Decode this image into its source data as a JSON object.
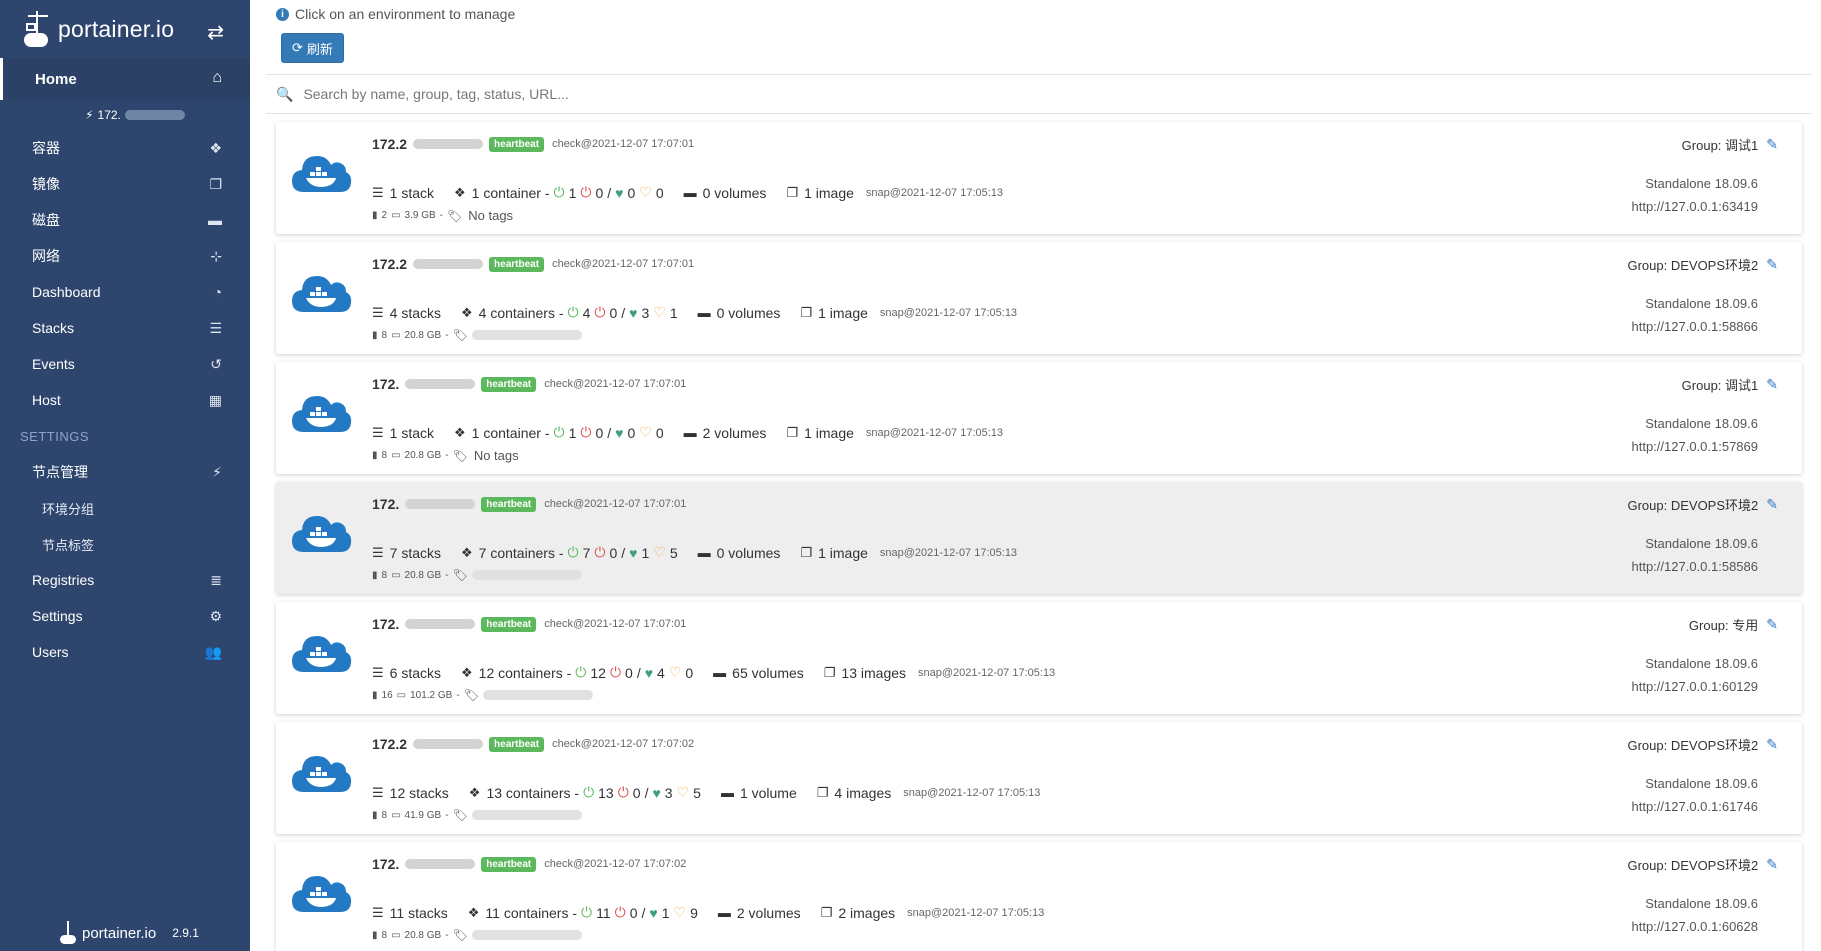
{
  "sidebar": {
    "brand": "portainer.io",
    "home_label": "Home",
    "endpoint_label": "172.",
    "items": [
      {
        "label": "容器",
        "icon": "cubes-icon"
      },
      {
        "label": "镜像",
        "icon": "clone-icon"
      },
      {
        "label": "磁盘",
        "icon": "hdd-icon"
      },
      {
        "label": "网络",
        "icon": "sitemap-icon"
      },
      {
        "label": "Dashboard",
        "icon": "dashboard-icon"
      },
      {
        "label": "Stacks",
        "icon": "th-list-icon"
      },
      {
        "label": "Events",
        "icon": "history-icon"
      },
      {
        "label": "Host",
        "icon": "th-icon"
      }
    ],
    "settings_header": "SETTINGS",
    "settings_items": {
      "node_mgmt": "节点管理",
      "env_group": "环境分组",
      "node_tags": "节点标签",
      "registries": "Registries",
      "settings": "Settings",
      "users": "Users"
    },
    "footer_name": "portainer.io",
    "footer_version": "2.9.1"
  },
  "main": {
    "info_text": "Click on an environment to manage",
    "refresh_label": "刷新",
    "search_placeholder": "Search by name, group, tag, status, URL..."
  },
  "endpoints": [
    {
      "name": "172.2",
      "badge": "heartbeat",
      "check": "check@2021-12-07 17:07:01",
      "stacks": "1 stack",
      "containers": "1 container -",
      "running": "1",
      "stopped": "0",
      "healthy": "0",
      "unhealthy": "0",
      "volumes": "0 volumes",
      "images": "1 image",
      "snap": "snap@2021-12-07 17:05:13",
      "cpu": "2",
      "mem": "3.9 GB",
      "tags": "No tags",
      "group": "Group: 调试1",
      "standalone": "Standalone 18.09.6",
      "url": "http://127.0.0.1:63419"
    },
    {
      "name": "172.2",
      "badge": "heartbeat",
      "check": "check@2021-12-07 17:07:01",
      "stacks": "4 stacks",
      "containers": "4 containers -",
      "running": "4",
      "stopped": "0",
      "healthy": "3",
      "unhealthy": "1",
      "volumes": "0 volumes",
      "images": "1 image",
      "snap": "snap@2021-12-07 17:05:13",
      "cpu": "8",
      "mem": "20.8 GB",
      "tags": "-",
      "group": "Group: DEVOPS环境2",
      "standalone": "Standalone 18.09.6",
      "url": "http://127.0.0.1:58866"
    },
    {
      "name": "172.",
      "badge": "heartbeat",
      "check": "check@2021-12-07 17:07:01",
      "stacks": "1 stack",
      "containers": "1 container -",
      "running": "1",
      "stopped": "0",
      "healthy": "0",
      "unhealthy": "0",
      "volumes": "2 volumes",
      "images": "1 image",
      "snap": "snap@2021-12-07 17:05:13",
      "cpu": "8",
      "mem": "20.8 GB",
      "tags": "No tags",
      "group": "Group: 调试1",
      "standalone": "Standalone 18.09.6",
      "url": "http://127.0.0.1:57869"
    },
    {
      "name": "172.",
      "badge": "heartbeat",
      "check": "check@2021-12-07 17:07:01",
      "stacks": "7 stacks",
      "containers": "7 containers -",
      "running": "7",
      "stopped": "0",
      "healthy": "1",
      "unhealthy": "5",
      "volumes": "0 volumes",
      "images": "1 image",
      "snap": "snap@2021-12-07 17:05:13",
      "cpu": "8",
      "mem": "20.8 GB",
      "tags": "-",
      "group": "Group: DEVOPS环境2",
      "standalone": "Standalone 18.09.6",
      "url": "http://127.0.0.1:58586"
    },
    {
      "name": "172.",
      "badge": "heartbeat",
      "check": "check@2021-12-07 17:07:01",
      "stacks": "6 stacks",
      "containers": "12 containers -",
      "running": "12",
      "stopped": "0",
      "healthy": "4",
      "unhealthy": "0",
      "volumes": "65 volumes",
      "images": "13 images",
      "snap": "snap@2021-12-07 17:05:13",
      "cpu": "16",
      "mem": "101.2 GB",
      "tags": "-",
      "group": "Group: 专用",
      "standalone": "Standalone 18.09.6",
      "url": "http://127.0.0.1:60129"
    },
    {
      "name": "172.2",
      "badge": "heartbeat",
      "check": "check@2021-12-07 17:07:02",
      "stacks": "12 stacks",
      "containers": "13 containers -",
      "running": "13",
      "stopped": "0",
      "healthy": "3",
      "unhealthy": "5",
      "volumes": "1 volume",
      "images": "4 images",
      "snap": "snap@2021-12-07 17:05:13",
      "cpu": "8",
      "mem": "41.9 GB",
      "tags": "-",
      "group": "Group: DEVOPS环境2",
      "standalone": "Standalone 18.09.6",
      "url": "http://127.0.0.1:61746"
    },
    {
      "name": "172.",
      "badge": "heartbeat",
      "check": "check@2021-12-07 17:07:02",
      "stacks": "11 stacks",
      "containers": "11 containers -",
      "running": "11",
      "stopped": "0",
      "healthy": "1",
      "unhealthy": "9",
      "volumes": "2 volumes",
      "images": "2 images",
      "snap": "snap@2021-12-07 17:05:13",
      "cpu": "8",
      "mem": "20.8 GB",
      "tags": "-",
      "group": "Group: DEVOPS环境2",
      "standalone": "Standalone 18.09.6",
      "url": "http://127.0.0.1:60628"
    }
  ]
}
